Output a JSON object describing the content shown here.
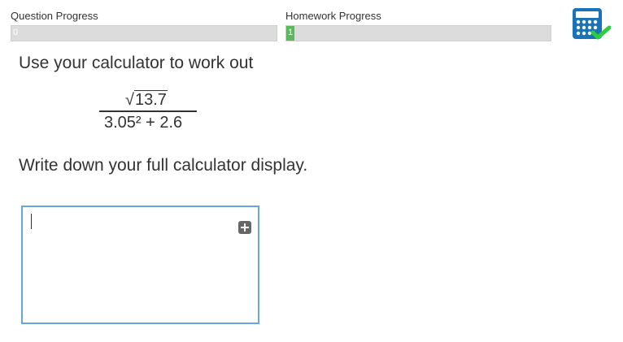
{
  "question_progress": {
    "label": "Question Progress",
    "value": "0",
    "fraction": 0
  },
  "homework_progress": {
    "label": "Homework Progress",
    "value": "1",
    "fraction": 0.03
  },
  "calculator_icon": {
    "name": "calculator-allowed-icon",
    "colors": {
      "body": "#1a73b9",
      "check": "#2ecc40"
    }
  },
  "question": {
    "instruction": "Use your calculator to work out",
    "numerator": "13.7",
    "numerator_symbol": "√",
    "denominator": "3.05² + 2.6",
    "prompt": "Write down your full calculator display."
  },
  "answer": {
    "value": ""
  },
  "colors": {
    "progress_fill": "#5cb85c",
    "progress_track": "#dcdcdc",
    "answer_border": "#6aa6d6"
  }
}
